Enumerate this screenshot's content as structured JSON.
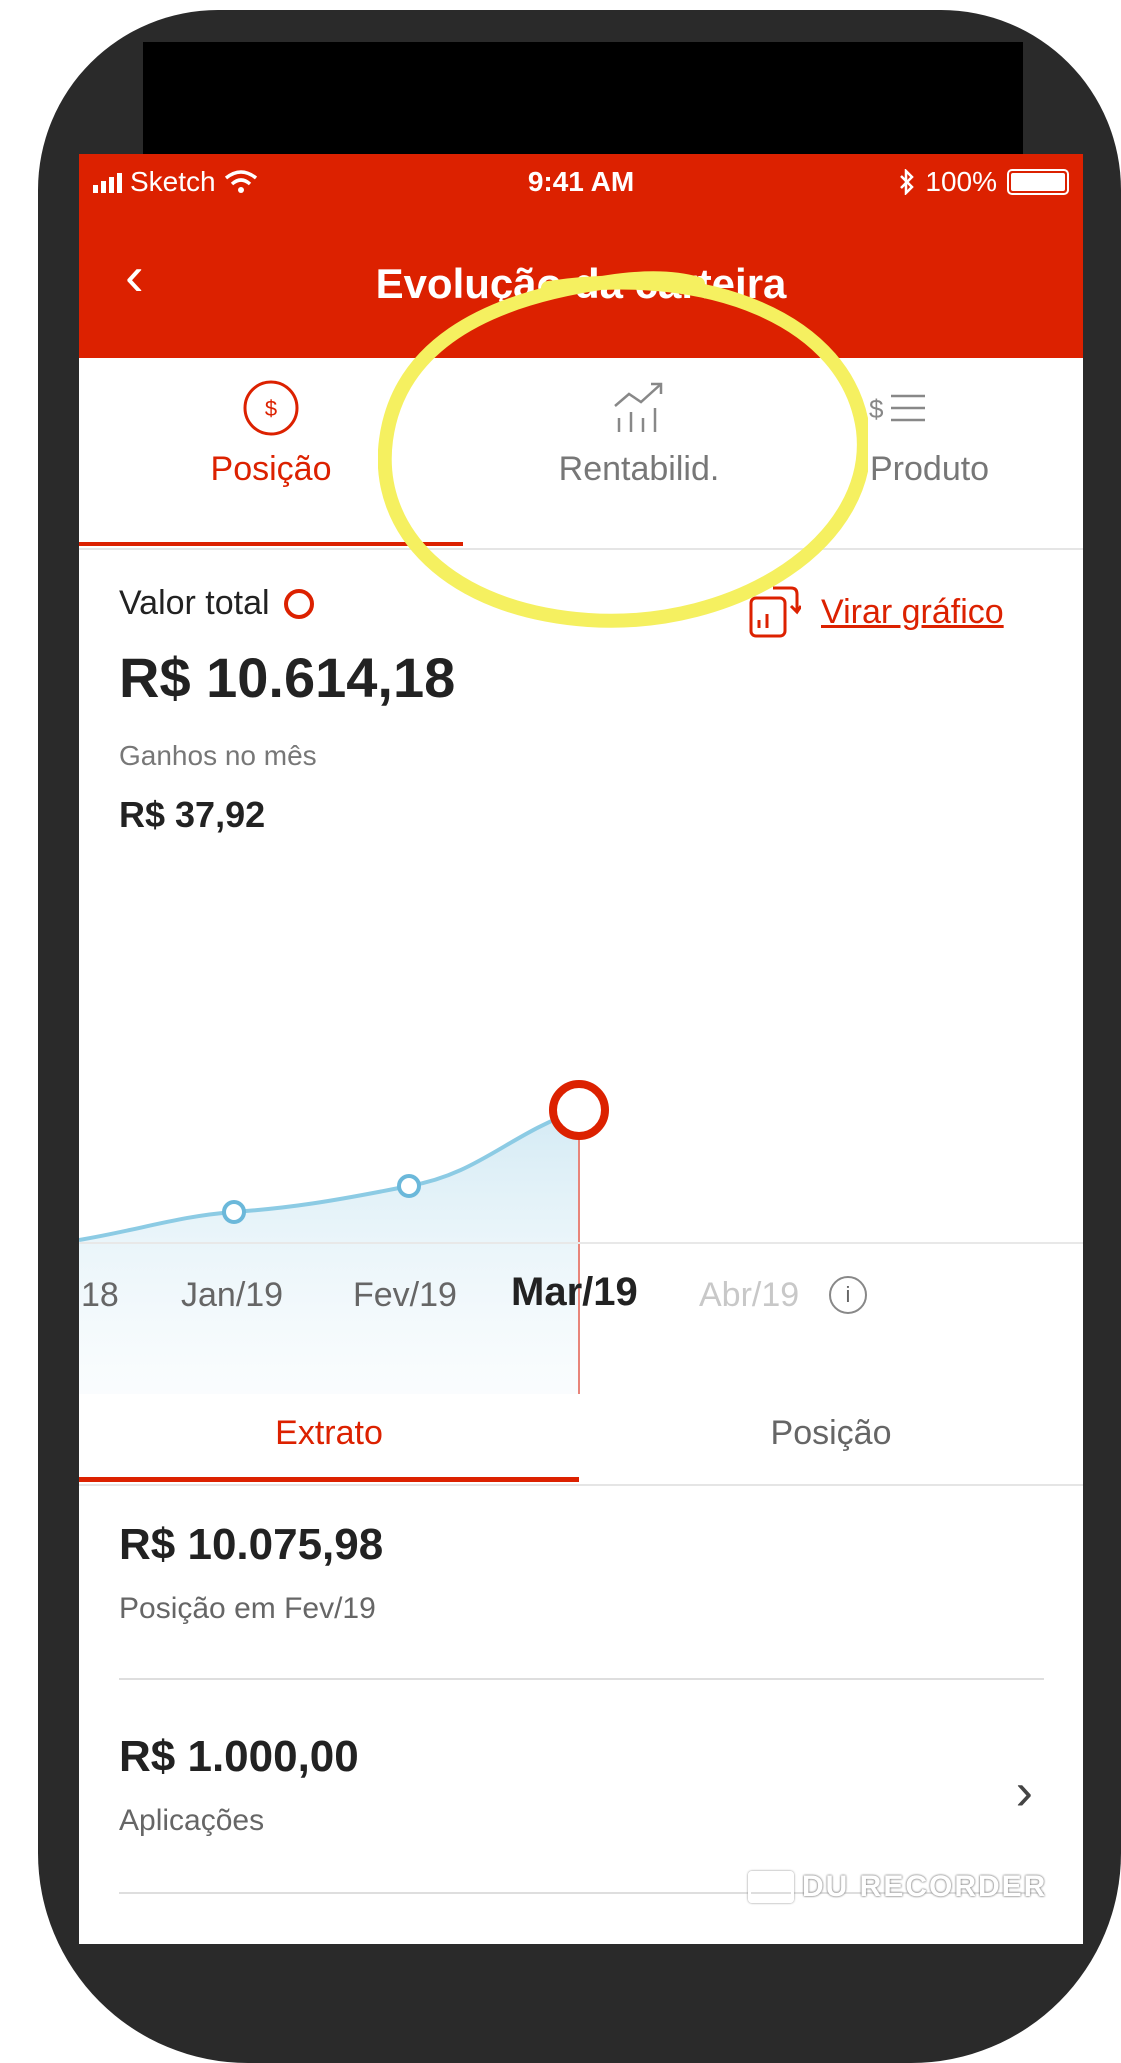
{
  "status": {
    "carrier": "Sketch",
    "time": "9:41 AM",
    "battery": "100%"
  },
  "nav": {
    "back_glyph": "‹",
    "title": "Evolução da carteira"
  },
  "tabs": [
    {
      "label": "Posição",
      "icon": "dollar-circle-icon",
      "active": true
    },
    {
      "label": "Rentabilid.",
      "icon": "growth-chart-icon",
      "active": false
    },
    {
      "label": "Produto",
      "icon": "dollar-list-icon",
      "active": false
    }
  ],
  "summary": {
    "value_label": "Valor total",
    "total": "R$ 10.614,18",
    "gains_label": "Ganhos no mês",
    "gains": "R$ 37,92",
    "flip_label": "Virar gráfico"
  },
  "chart_data": {
    "type": "area",
    "x": [
      "18",
      "Jan/19",
      "Fev/19",
      "Mar/19",
      "Abr/19"
    ],
    "selected": "Mar/19",
    "accent_color": "#dc2100",
    "line_color": "#8ccbe4"
  },
  "months": {
    "prev": "18",
    "jan": "Jan/19",
    "fev": "Fev/19",
    "mar": "Mar/19",
    "abr": "Abr/19",
    "info_glyph": "i"
  },
  "subtabs": {
    "extrato": "Extrato",
    "posicao": "Posição"
  },
  "rows": [
    {
      "amount": "R$ 10.075,98",
      "desc": "Posição em Fev/19"
    },
    {
      "amount": "R$ 1.000,00",
      "desc": "Aplicações"
    }
  ],
  "row_chevron": "›",
  "watermark": "DU RECORDER",
  "colors": {
    "brand": "#dc2100",
    "highlight": "#f5f060"
  }
}
